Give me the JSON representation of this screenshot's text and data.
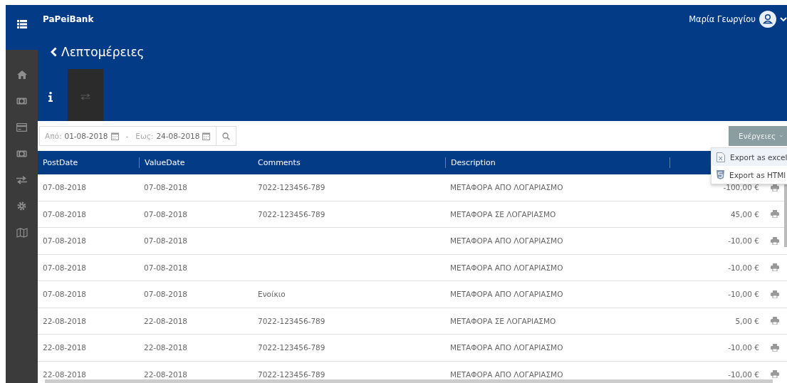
{
  "brand": "PaPeiBank",
  "user": {
    "name": "Μαρία Γεωργίου"
  },
  "sidebar": {
    "items": [
      {
        "kind": "home",
        "selected": false
      },
      {
        "kind": "money",
        "selected": false
      },
      {
        "kind": "card",
        "selected": false
      },
      {
        "kind": "money",
        "selected": false
      },
      {
        "kind": "transfer",
        "selected": false
      },
      {
        "kind": "gear",
        "selected": false
      },
      {
        "kind": "map",
        "selected": false
      }
    ]
  },
  "page_title": "Λεπτομέρειες",
  "tabs": [
    {
      "kind": "info",
      "selected": false
    },
    {
      "kind": "transfer",
      "selected": true
    }
  ],
  "filter": {
    "from_label": "Από:",
    "from_value": "01-08-2018",
    "separator": "-",
    "to_label": "Εως:",
    "to_value": "24-08-2018"
  },
  "actions": {
    "label": "Ενέργειες",
    "expanded": true,
    "items": [
      {
        "kind": "excel",
        "label": "Export as excel"
      },
      {
        "kind": "html",
        "label": "Export as HTMl"
      }
    ]
  },
  "table": {
    "columns": [
      "PostDate",
      "ValueDate",
      "Comments",
      "Description"
    ],
    "rows": [
      {
        "post_date": "07-08-2018",
        "value_date": "07-08-2018",
        "comments": "7022-123456-789",
        "description": "ΜΕΤΑΦΟΡΑ ΑΠΟ ΛΟΓΑΡΙΑΣΜΟ",
        "amount": "-100,00 €"
      },
      {
        "post_date": "07-08-2018",
        "value_date": "07-08-2018",
        "comments": "7022-123456-789",
        "description": "ΜΕΤΑΦΟΡΑ ΣΕ ΛΟΓΑΡΙΑΣΜΟ",
        "amount": "45,00 €"
      },
      {
        "post_date": "07-08-2018",
        "value_date": "07-08-2018",
        "description": "ΜΕΤΑΦΟΡΑ ΑΠΟ ΛΟΓΑΡΙΑΣΜΟ",
        "amount": "-10,00 €"
      },
      {
        "post_date": "07-08-2018",
        "value_date": "07-08-2018",
        "description": "ΜΕΤΑΦΟΡΑ ΑΠΟ ΛΟΓΑΡΙΑΣΜΟ",
        "amount": "-10,00 €"
      },
      {
        "post_date": "07-08-2018",
        "value_date": "07-08-2018",
        "comments": "Ενοίκιο",
        "description": "ΜΕΤΑΦΟΡΑ ΑΠΟ ΛΟΓΑΡΙΑΣΜΟ",
        "amount": "-10,00 €"
      },
      {
        "post_date": "22-08-2018",
        "value_date": "22-08-2018",
        "comments": "7022-123456-789",
        "description": "ΜΕΤΑΦΟΡΑ ΣΕ ΛΟΓΑΡΙΑΣΜΟ",
        "amount": "5,00 €"
      },
      {
        "post_date": "22-08-2018",
        "value_date": "22-08-2018",
        "comments": "7022-123456-789",
        "description": "ΜΕΤΑΦΟΡΑ ΑΠΟ ΛΟΓΑΡΙΑΣΜΟ",
        "amount": "-10,00 €"
      },
      {
        "post_date": "22-08-2018",
        "value_date": "22-08-2018",
        "comments": "7022-123456-789",
        "description": "ΜΕΤΑΦΟΡΑ ΑΠΟ ΛΟΓΑΡΙΑΣΜΟ",
        "amount": "-10,00 €"
      }
    ]
  }
}
